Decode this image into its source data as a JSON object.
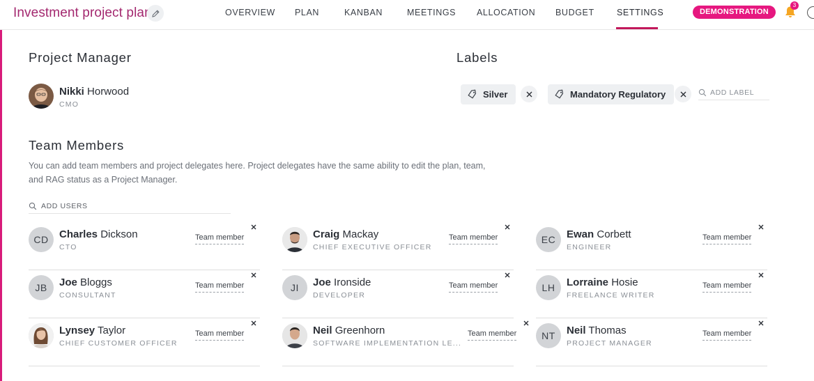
{
  "header": {
    "project_title": "Investment project plan",
    "tabs": [
      {
        "label": "OVERVIEW"
      },
      {
        "label": "PLAN"
      },
      {
        "label": "KANBAN"
      },
      {
        "label": "MEETINGS"
      },
      {
        "label": "ALLOCATION"
      },
      {
        "label": "BUDGET"
      },
      {
        "label": "SETTINGS",
        "active": true
      }
    ],
    "badge": "DEMONSTRATION",
    "notification_count": "3",
    "accent_color": "#e6177f"
  },
  "project_manager": {
    "section_title": "Project Manager",
    "first_name": "Nikki",
    "last_name": "Horwood",
    "role": "CMO"
  },
  "labels": {
    "section_title": "Labels",
    "items": [
      {
        "label": "Silver"
      },
      {
        "label": "Mandatory Regulatory"
      }
    ],
    "add_placeholder": "ADD LABEL"
  },
  "team": {
    "section_title": "Team Members",
    "description": "You can add team members and project delegates here. Project delegates have the same ability to edit the plan, team, and RAG status as a Project Manager.",
    "add_placeholder": "ADD USERS",
    "members": [
      {
        "initials": "CD",
        "first": "Charles",
        "last": "Dickson",
        "role": "CTO",
        "tag": "Team member"
      },
      {
        "initials": "",
        "first": "Craig",
        "last": "Mackay",
        "role": "CHIEF EXECUTIVE OFFICER",
        "tag": "Team member",
        "photo": true
      },
      {
        "initials": "EC",
        "first": "Ewan",
        "last": "Corbett",
        "role": "ENGINEER",
        "tag": "Team member"
      },
      {
        "initials": "JB",
        "first": "Joe",
        "last": "Bloggs",
        "role": "CONSULTANT",
        "tag": "Team member"
      },
      {
        "initials": "JI",
        "first": "Joe",
        "last": "Ironside",
        "role": "DEVELOPER",
        "tag": "Team member"
      },
      {
        "initials": "LH",
        "first": "Lorraine",
        "last": "Hosie",
        "role": "FREELANCE WRITER",
        "tag": "Team member"
      },
      {
        "initials": "",
        "first": "Lynsey",
        "last": "Taylor",
        "role": "CHIEF CUSTOMER OFFICER",
        "tag": "Team member",
        "photo": true
      },
      {
        "initials": "",
        "first": "Neil",
        "last": "Greenhorn",
        "role": "SOFTWARE IMPLEMENTATION LE...",
        "tag": "Team member",
        "photo": true
      },
      {
        "initials": "NT",
        "first": "Neil",
        "last": "Thomas",
        "role": "PROJECT MANAGER",
        "tag": "Team member"
      }
    ]
  }
}
